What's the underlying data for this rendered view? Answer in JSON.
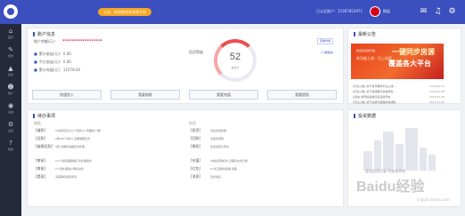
{
  "header": {
    "notice": "公告：欢迎使用本系统平台",
    "user_info": "已认证账户：15367852971",
    "user_label": "财运",
    "icons": [
      "chat-icon",
      "bell-icon",
      "settings-icon"
    ]
  },
  "sidebar": {
    "items": [
      {
        "label": "首页",
        "icon": "home-icon"
      },
      {
        "label": "借款",
        "icon": "loan-icon"
      },
      {
        "label": "投资",
        "icon": "invest-icon"
      },
      {
        "label": "账户",
        "icon": "account-icon"
      },
      {
        "label": "资金",
        "icon": "funds-icon"
      },
      {
        "label": "设置",
        "icon": "settings-icon"
      },
      {
        "label": "帮助",
        "icon": "help-icon"
      }
    ]
  },
  "account": {
    "title": "账户信息",
    "name_label": "账户余额(元)：",
    "masked": "******************",
    "manage_btn": "查看详情",
    "lines": [
      "累计收益(元)：0.00",
      "今日收益(元)：0.00",
      "累计充值(元)：11578.00"
    ],
    "level_label": "信用等级",
    "level_link": "[了解更多]",
    "score": "52",
    "score_label": "信用分"
  },
  "actions": [
    "快速投入",
    "我要借款",
    "我要充值",
    "我要提现"
  ],
  "todo": {
    "title": "待办事项",
    "col_left": "借款",
    "col_right": "投资",
    "left_rows": [
      {
        "tag": "[借款]",
        "text": "15笔待还款(23个借款人) 待偿还17期"
      },
      {
        "tag": "[还款]",
        "text": "2笔(46个用户) 近期需要还款"
      },
      {
        "tag": "[逾期还款]",
        "text": "0笔 近期有逾期还款处理"
      }
    ],
    "left_rows2": [
      {
        "tag": "[审核]",
        "text": "10个借款需要审核 待处理借款"
      },
      {
        "tag": "[审核]",
        "text": "2个待处理用户审核资料"
      },
      {
        "tag": "[提现]",
        "text": "无需审核提现申请"
      }
    ],
    "right_rows": [
      {
        "tag": "[投资]",
        "text": "无投资待处理"
      },
      {
        "tag": "[回款]",
        "text": "无回款到账"
      },
      {
        "tag": "[债权]",
        "text": "无债权转让申请"
      }
    ],
    "right_rows2": [
      {
        "tag": "[充值]",
        "text": "0笔充值审核中 近期有充值记录"
      },
      {
        "tag": "[红包]",
        "text": "0个红包即将到期 领取"
      },
      {
        "tag": "[消息]",
        "text": "无新消息"
      }
    ]
  },
  "news": {
    "title": "最新公告",
    "banner_small": "财运宝全新升级",
    "banner_big1": "一键同步房源",
    "banner_big2": "覆盖各大平台",
    "banner_sub": "新功能上线 · 马上体验",
    "items": [
      {
        "text": "[平台公告] 关于春节期间平台上线...",
        "date": "2016/02/12"
      },
      {
        "text": "[平台公告] 关于完成银行资金存管...",
        "date": "2016/01/08"
      },
      {
        "text": "[活动] 新年投资送红包活动开启",
        "date": "2015/12/30"
      },
      {
        "text": "[平台公告] 关于系统升级维护的通知",
        "date": "2015/12/20"
      }
    ]
  },
  "stats": {
    "title": "投资数据",
    "caption": "暂无投资记录 开始投资吧",
    "watermark": "Baidu经验",
    "watermark_sub": "jingyan.baidu.com"
  }
}
